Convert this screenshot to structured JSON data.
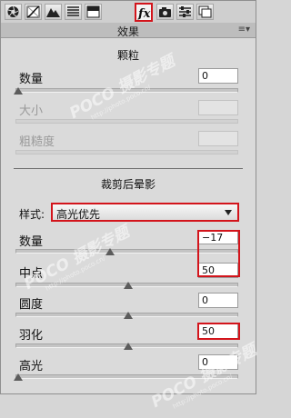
{
  "toolbar": {
    "tabs": [
      {
        "icon": "aperture-icon",
        "active": false
      },
      {
        "icon": "tone-curve-icon",
        "active": false
      },
      {
        "icon": "mountains-icon",
        "active": false
      },
      {
        "icon": "hsl-lines-icon",
        "active": false
      },
      {
        "icon": "split-toning-icon",
        "active": false
      },
      {
        "icon": "fx-icon",
        "label": "fx",
        "active": true
      },
      {
        "icon": "camera-icon",
        "active": false
      },
      {
        "icon": "presets-sliders-icon",
        "active": false
      },
      {
        "icon": "snapshots-icon",
        "active": false
      }
    ]
  },
  "panel": {
    "title": "效果",
    "menu_icon": "panel-menu-icon"
  },
  "grain": {
    "section_title": "颗粒",
    "amount": {
      "label": "数量",
      "value": "0",
      "enabled": true
    },
    "size": {
      "label": "大小",
      "value": "",
      "enabled": false
    },
    "roughness": {
      "label": "粗糙度",
      "value": "",
      "enabled": false
    }
  },
  "vignette": {
    "section_title": "裁剪后晕影",
    "style_label": "样式:",
    "style_value": "高光优先",
    "amount": {
      "label": "数量",
      "value": "−17"
    },
    "midpoint": {
      "label": "中点",
      "value": "50"
    },
    "roundness": {
      "label": "圆度",
      "value": "0"
    },
    "feather": {
      "label": "羽化",
      "value": "50"
    },
    "highlights": {
      "label": "高光",
      "value": "0"
    }
  },
  "watermark": {
    "text": "POCO 摄影专题",
    "url": "http://photo.poco.cn/"
  },
  "colors": {
    "highlight": "#d3141b",
    "panel_bg": "#dadada"
  }
}
